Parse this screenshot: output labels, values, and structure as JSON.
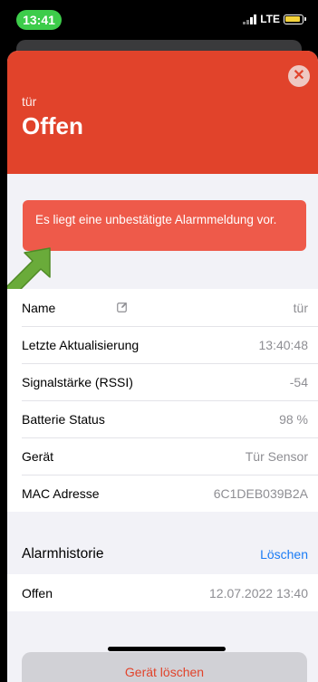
{
  "status_bar": {
    "time": "13:41",
    "network": "LTE"
  },
  "header": {
    "subtitle": "tür",
    "title": "Offen"
  },
  "alert": {
    "message": "Es liegt eine unbestätigte Alarmmeldung vor."
  },
  "details": [
    {
      "label": "Name",
      "value": "tür"
    },
    {
      "label": "Letzte Aktualisierung",
      "value": "13:40:48"
    },
    {
      "label": "Signalstärke (RSSI)",
      "value": "-54"
    },
    {
      "label": "Batterie Status",
      "value": "98 %"
    },
    {
      "label": "Gerät",
      "value": "Tür Sensor"
    },
    {
      "label": "MAC Adresse",
      "value": "6C1DEB039B2A"
    }
  ],
  "history": {
    "title": "Alarmhistorie",
    "clear_label": "Löschen",
    "entries": [
      {
        "label": "Offen",
        "value": "12.07.2022 13:40"
      }
    ]
  },
  "delete_button": {
    "label": "Gerät löschen"
  },
  "colors": {
    "header": "#e1432b",
    "alert": "#ee5a4a",
    "arrow": "#6aab3a",
    "link": "#1a7cf5"
  }
}
